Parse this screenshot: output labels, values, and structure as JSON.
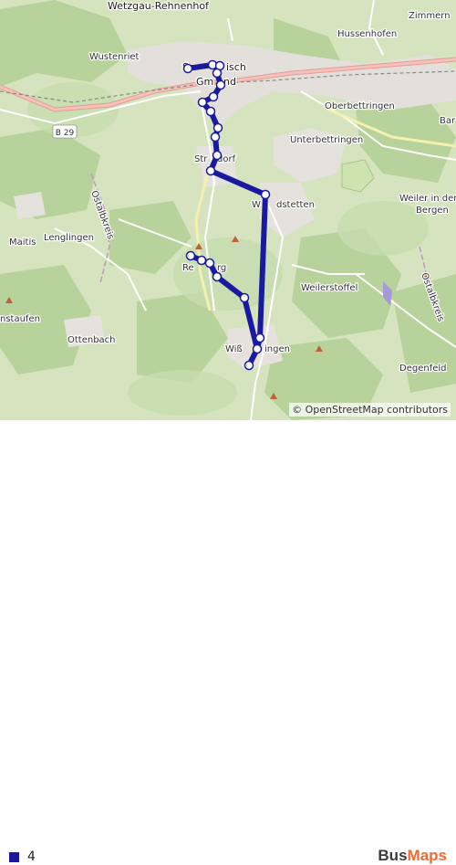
{
  "map": {
    "place_labels": [
      {
        "id": "wetzgau",
        "text": "Wetzgau-Rehnenhof"
      },
      {
        "id": "zimmern",
        "text": "Zimmern"
      },
      {
        "id": "hussenhofen",
        "text": "Hussenhofen"
      },
      {
        "id": "wustenriet",
        "text": "Wustenriet"
      },
      {
        "id": "gmuend-a",
        "text": "Sc"
      },
      {
        "id": "gmuend-b",
        "text": "isch"
      },
      {
        "id": "gmuend-c",
        "text": "Gm"
      },
      {
        "id": "gmuend-d",
        "text": "nd"
      },
      {
        "id": "oberbettringen",
        "text": "Oberbettringen"
      },
      {
        "id": "bar",
        "text": "Bar"
      },
      {
        "id": "unterbettringen",
        "text": "Unterbettringen"
      },
      {
        "id": "straussdorf-a",
        "text": "Str"
      },
      {
        "id": "straussdorf-b",
        "text": "dorf"
      },
      {
        "id": "waldstetten-a",
        "text": "W"
      },
      {
        "id": "waldstetten-b",
        "text": "dstetten"
      },
      {
        "id": "weiler-a",
        "text": "Weiler in den"
      },
      {
        "id": "weiler-b",
        "text": "Bergen"
      },
      {
        "id": "maitis",
        "text": "Maitis"
      },
      {
        "id": "lenglingen",
        "text": "Lenglingen"
      },
      {
        "id": "rechberg-a",
        "text": "Re"
      },
      {
        "id": "rechberg-b",
        "text": "rg"
      },
      {
        "id": "weilerstoffel",
        "text": "Weilerstoffel"
      },
      {
        "id": "staufen",
        "text": "nstaufen"
      },
      {
        "id": "ottenbach",
        "text": "Ottenbach"
      },
      {
        "id": "wissgoldingen-a",
        "text": "Wiß"
      },
      {
        "id": "wissgoldingen-b",
        "text": "ingen"
      },
      {
        "id": "degenfeld",
        "text": "Degenfeld"
      },
      {
        "id": "ostalbkreis-1",
        "text": "Ostalbkreis"
      },
      {
        "id": "ostalbkreis-2",
        "text": "Ostalbkreis"
      }
    ],
    "road_label": "B 29",
    "attribution": "© OpenStreetMap contributors",
    "route": {
      "color": "#1a1aa0",
      "stop_count": 19
    }
  },
  "legend": {
    "line_name": "4",
    "line_color": "#1a1aa0"
  },
  "brand": {
    "part1": "Bus",
    "part2": "Maps"
  }
}
